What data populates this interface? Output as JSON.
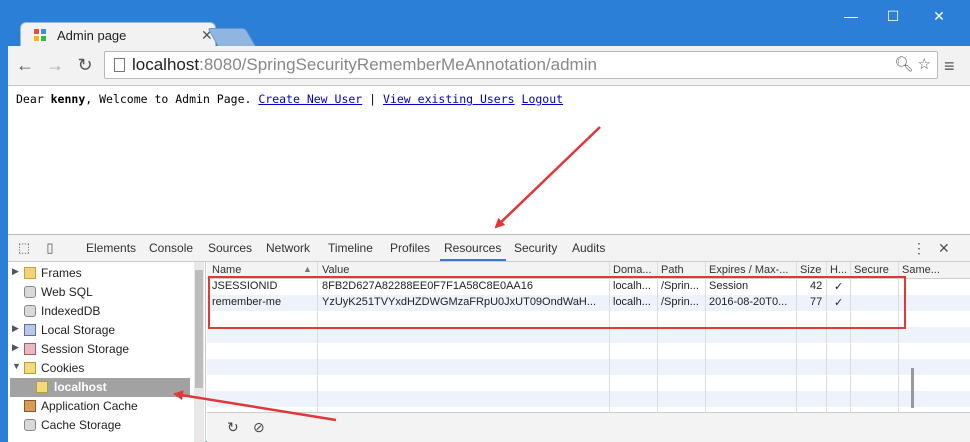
{
  "browser": {
    "tab_title": "Admin page",
    "url_host": "localhost",
    "url_port": ":8080",
    "url_path": "/SpringSecurityRememberMeAnnotation/admin"
  },
  "page": {
    "greeting_prefix": "Dear ",
    "username": "kenny",
    "greeting_suffix": ", Welcome to Admin Page.",
    "link_create": "Create New User",
    "separator": "|",
    "link_view": "View existing Users",
    "link_logout": "Logout"
  },
  "devtools": {
    "tabs": [
      "Elements",
      "Console",
      "Sources",
      "Network",
      "Timeline",
      "Profiles",
      "Resources",
      "Security",
      "Audits"
    ],
    "active_tab": "Resources",
    "sidebar": [
      {
        "label": "Frames",
        "arrow": "▶"
      },
      {
        "label": "Web SQL",
        "arrow": ""
      },
      {
        "label": "IndexedDB",
        "arrow": ""
      },
      {
        "label": "Local Storage",
        "arrow": "▶"
      },
      {
        "label": "Session Storage",
        "arrow": "▶"
      },
      {
        "label": "Cookies",
        "arrow": "▼"
      },
      {
        "label": "localhost",
        "arrow": ""
      },
      {
        "label": "Application Cache",
        "arrow": ""
      },
      {
        "label": "Cache Storage",
        "arrow": ""
      }
    ],
    "columns": [
      "Name",
      "Value",
      "Doma...",
      "Path",
      "Expires / Max-...",
      "Size",
      "H...",
      "Secure",
      "Same..."
    ],
    "cookies": [
      {
        "name": "JSESSIONID",
        "value": "8FB2D627A82288EE0F7F1A58C8E0AA16",
        "domain": "localh...",
        "path": "/Sprin...",
        "expires": "Session",
        "size": "42",
        "http": "✓"
      },
      {
        "name": "remember-me",
        "value": "YzUyK251TVYxdHZDWGMzaFRpU0JxUT09OndWaH...",
        "domain": "localh...",
        "path": "/Sprin...",
        "expires": "2016-08-20T0...",
        "size": "77",
        "http": "✓"
      }
    ]
  },
  "colors": {
    "accent": "#3879d9",
    "annotation": "#e03838"
  }
}
